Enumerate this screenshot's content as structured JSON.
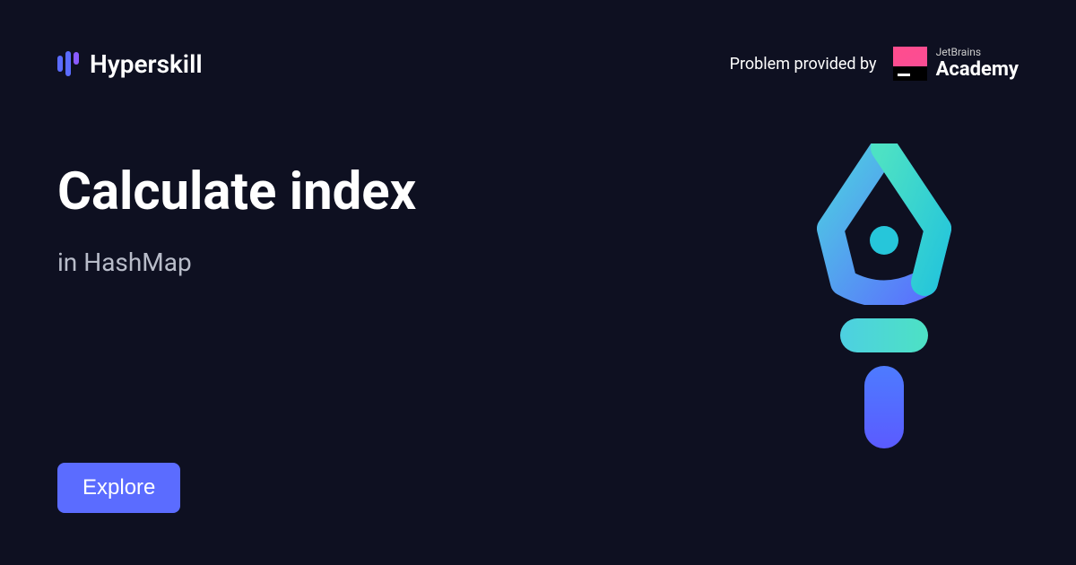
{
  "header": {
    "brand_name": "Hyperskill",
    "provided_text": "Problem provided by",
    "jetbrains_small": "JetBrains",
    "jetbrains_large": "Academy"
  },
  "main": {
    "title": "Calculate index",
    "subtitle": "in HashMap"
  },
  "cta": {
    "explore_label": "Explore"
  }
}
